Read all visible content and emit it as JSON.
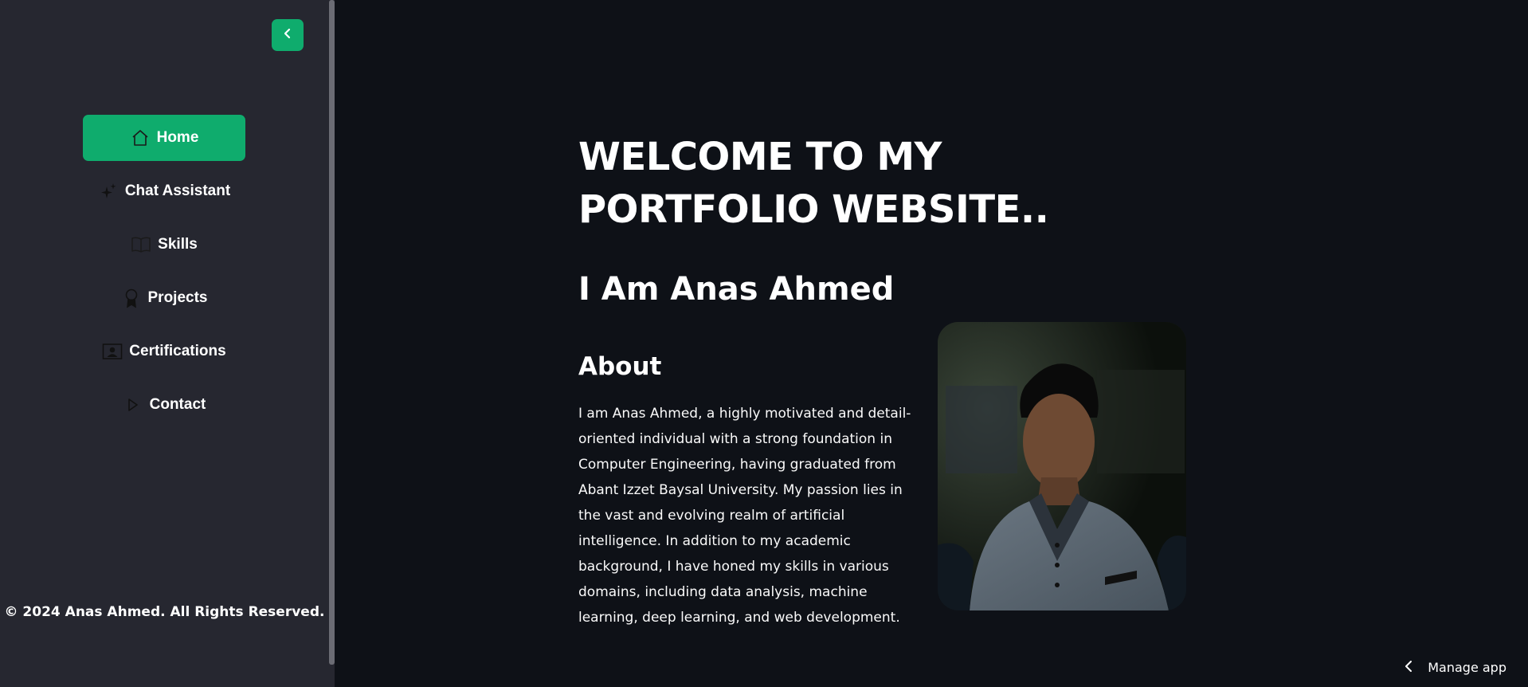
{
  "sidebar": {
    "collapse_icon": "chevron-left-icon",
    "nav_items": [
      {
        "label": "Home",
        "icon": "house-icon",
        "active": true
      },
      {
        "label": "Chat Assistant",
        "icon": "sparkles-icon",
        "active": false
      },
      {
        "label": "Skills",
        "icon": "book-icon",
        "active": false
      },
      {
        "label": "Projects",
        "icon": "award-icon",
        "active": false
      },
      {
        "label": "Certifications",
        "icon": "person-badge-icon",
        "active": false
      },
      {
        "label": "Contact",
        "icon": "play-icon",
        "active": false
      }
    ],
    "copyright": "© 2024 Anas Ahmed. All Rights Reserved."
  },
  "main": {
    "title": "WELCOME TO MY PORTFOLIO WEBSITE..",
    "subtitle": "I Am Anas Ahmed",
    "about_heading": "About",
    "about_text": "I am Anas Ahmed, a highly motivated and detail-oriented individual with a strong foundation in Computer Engineering, having graduated from Abant Izzet Baysal University. My passion lies in the vast and evolving realm of artificial intelligence. In addition to my academic background, I have honed my skills in various domains, including data analysis, machine learning, deep learning, and web development."
  },
  "footer": {
    "manage_app_label": "Manage app"
  },
  "colors": {
    "accent": "#0fac6d",
    "sidebar_bg": "#262730",
    "main_bg": "#0e1117"
  }
}
